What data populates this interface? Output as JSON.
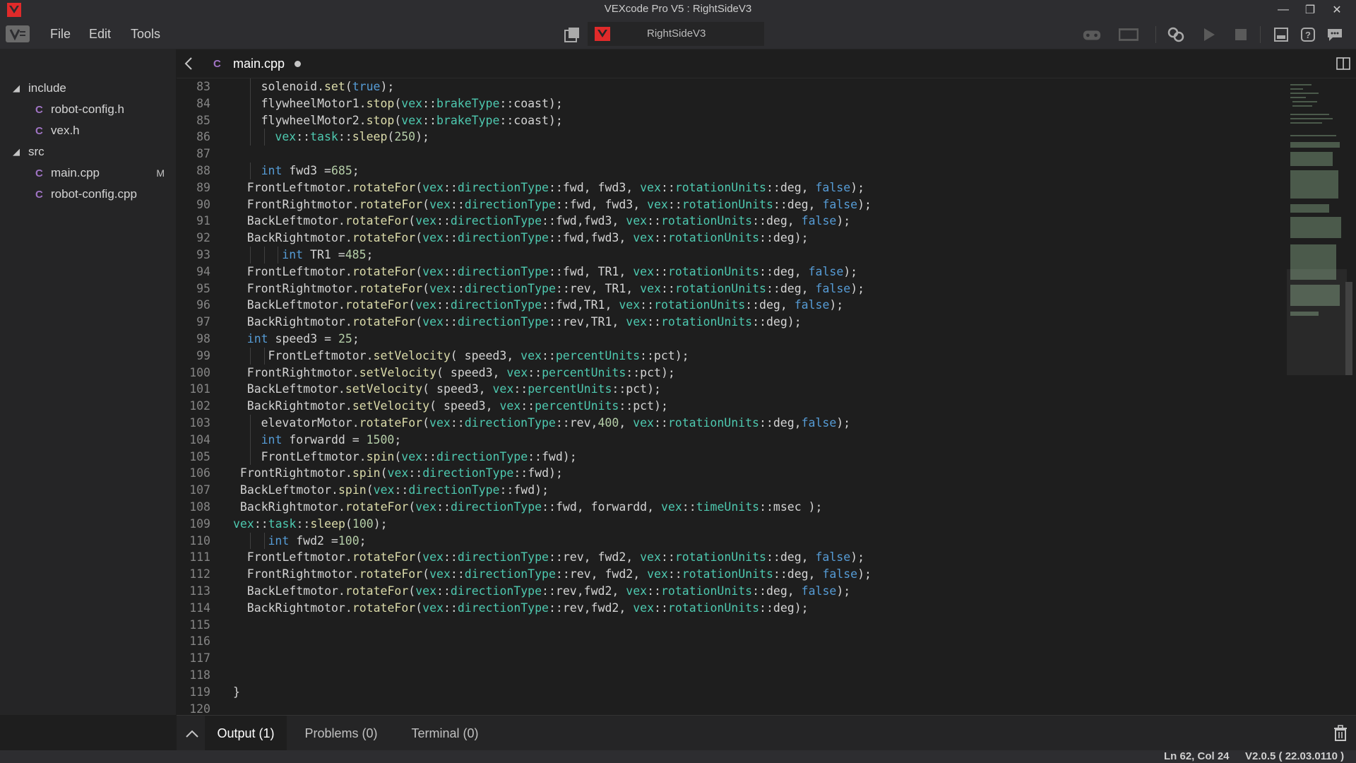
{
  "window": {
    "title": "VEXcode Pro V5 : RightSideV3"
  },
  "menu": {
    "items": [
      "File",
      "Edit",
      "Tools"
    ]
  },
  "project": {
    "name": "RightSideV3"
  },
  "explorer": {
    "folders": [
      {
        "name": "include",
        "files": [
          "robot-config.h",
          "vex.h"
        ]
      },
      {
        "name": "src",
        "files": [
          "main.cpp",
          "robot-config.cpp"
        ]
      }
    ],
    "modified_badge": "M"
  },
  "tab": {
    "label": "main.cpp"
  },
  "code_lines": [
    {
      "n": "83",
      "indent": 4,
      "text": "solenoid.set(true);"
    },
    {
      "n": "84",
      "indent": 4,
      "text": "flywheelMotor1.stop(vex::brakeType::coast);"
    },
    {
      "n": "85",
      "indent": 4,
      "text": "flywheelMotor2.stop(vex::brakeType::coast);"
    },
    {
      "n": "86",
      "indent": 6,
      "text": "vex::task::sleep(250);"
    },
    {
      "n": "87",
      "indent": 0,
      "text": ""
    },
    {
      "n": "88",
      "indent": 4,
      "text": "int fwd3 =685;"
    },
    {
      "n": "89",
      "indent": 2,
      "text": "FrontLeftmotor.rotateFor(vex::directionType::fwd, fwd3, vex::rotationUnits::deg, false);"
    },
    {
      "n": "90",
      "indent": 2,
      "text": "FrontRightmotor.rotateFor(vex::directionType::fwd, fwd3, vex::rotationUnits::deg, false);"
    },
    {
      "n": "91",
      "indent": 2,
      "text": "BackLeftmotor.rotateFor(vex::directionType::fwd,fwd3, vex::rotationUnits::deg, false);"
    },
    {
      "n": "92",
      "indent": 2,
      "text": "BackRightmotor.rotateFor(vex::directionType::fwd,fwd3, vex::rotationUnits::deg);"
    },
    {
      "n": "93",
      "indent": 7,
      "text": "int TR1 =485;"
    },
    {
      "n": "94",
      "indent": 2,
      "text": "FrontLeftmotor.rotateFor(vex::directionType::fwd, TR1, vex::rotationUnits::deg, false);"
    },
    {
      "n": "95",
      "indent": 2,
      "text": "FrontRightmotor.rotateFor(vex::directionType::rev, TR1, vex::rotationUnits::deg, false);"
    },
    {
      "n": "96",
      "indent": 2,
      "text": "BackLeftmotor.rotateFor(vex::directionType::fwd,TR1, vex::rotationUnits::deg, false);"
    },
    {
      "n": "97",
      "indent": 2,
      "text": "BackRightmotor.rotateFor(vex::directionType::rev,TR1, vex::rotationUnits::deg);"
    },
    {
      "n": "98",
      "indent": 2,
      "text": "int speed3 = 25;"
    },
    {
      "n": "99",
      "indent": 5,
      "text": "FrontLeftmotor.setVelocity( speed3, vex::percentUnits::pct);"
    },
    {
      "n": "100",
      "indent": 2,
      "text": "FrontRightmotor.setVelocity( speed3, vex::percentUnits::pct);"
    },
    {
      "n": "101",
      "indent": 2,
      "text": "BackLeftmotor.setVelocity( speed3, vex::percentUnits::pct);"
    },
    {
      "n": "102",
      "indent": 2,
      "text": "BackRightmotor.setVelocity( speed3, vex::percentUnits::pct);"
    },
    {
      "n": "103",
      "indent": 4,
      "text": "elevatorMotor.rotateFor(vex::directionType::rev,400, vex::rotationUnits::deg,false);"
    },
    {
      "n": "104",
      "indent": 4,
      "text": "int forwardd = 1500;"
    },
    {
      "n": "105",
      "indent": 4,
      "text": "FrontLeftmotor.spin(vex::directionType::fwd);"
    },
    {
      "n": "106",
      "indent": 1,
      "text": "FrontRightmotor.spin(vex::directionType::fwd);"
    },
    {
      "n": "107",
      "indent": 1,
      "text": "BackLeftmotor.spin(vex::directionType::fwd);"
    },
    {
      "n": "108",
      "indent": 1,
      "text": "BackRightmotor.rotateFor(vex::directionType::fwd, forwardd, vex::timeUnits::msec );"
    },
    {
      "n": "109",
      "indent": 0,
      "text": "vex::task::sleep(100);"
    },
    {
      "n": "110",
      "indent": 5,
      "text": "int fwd2 =100;"
    },
    {
      "n": "111",
      "indent": 2,
      "text": "FrontLeftmotor.rotateFor(vex::directionType::rev, fwd2, vex::rotationUnits::deg, false);"
    },
    {
      "n": "112",
      "indent": 2,
      "text": "FrontRightmotor.rotateFor(vex::directionType::rev, fwd2, vex::rotationUnits::deg, false);"
    },
    {
      "n": "113",
      "indent": 2,
      "text": "BackLeftmotor.rotateFor(vex::directionType::rev,fwd2, vex::rotationUnits::deg, false);"
    },
    {
      "n": "114",
      "indent": 2,
      "text": "BackRightmotor.rotateFor(vex::directionType::rev,fwd2, vex::rotationUnits::deg);"
    },
    {
      "n": "115",
      "indent": 0,
      "text": ""
    },
    {
      "n": "116",
      "indent": 0,
      "text": ""
    },
    {
      "n": "117",
      "indent": 0,
      "text": ""
    },
    {
      "n": "118",
      "indent": 0,
      "text": ""
    },
    {
      "n": "119",
      "indent": 0,
      "text": "}"
    },
    {
      "n": "120",
      "indent": 0,
      "text": ""
    }
  ],
  "panel": {
    "tabs": [
      "Output (1)",
      "Problems (0)",
      "Terminal (0)"
    ],
    "active": 0
  },
  "status": {
    "cursor": "Ln 62, Col 24",
    "version": "V2.0.5 ( 22.03.0110 )"
  },
  "colors": {
    "accent_red": "#e02a2a",
    "keyword": "#569cd6",
    "type": "#4ec9b0",
    "function": "#dcdcaa",
    "number": "#b5cea8",
    "cpp_icon": "#a074c4"
  },
  "icons": [
    "vex-logo-icon",
    "minimize-icon",
    "maximize-icon",
    "close-icon",
    "vex-menu-icon",
    "project-icon",
    "controller-icon",
    "brain-icon",
    "build-icon",
    "download-icon",
    "play-icon",
    "stop-icon",
    "device-info-icon",
    "help-icon",
    "feedback-icon",
    "back-arrow-icon",
    "split-editor-icon",
    "chevron-up-icon",
    "trash-icon"
  ]
}
